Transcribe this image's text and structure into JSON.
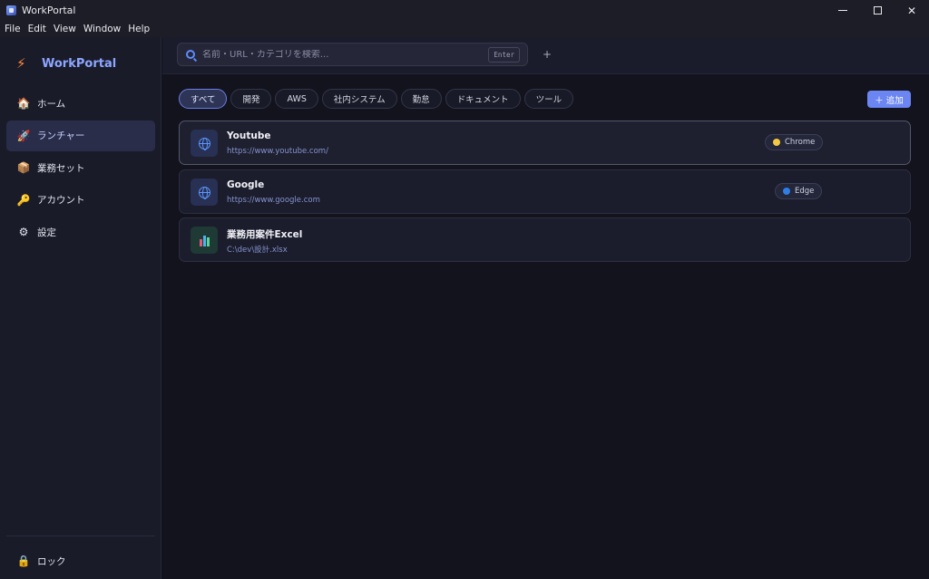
{
  "window": {
    "title": "WorkPortal"
  },
  "menu": [
    "File",
    "Edit",
    "View",
    "Window",
    "Help"
  ],
  "brand": {
    "label": "WorkPortal"
  },
  "sidebar": {
    "items": [
      {
        "label": "ホーム",
        "icon": "house-icon",
        "active": false
      },
      {
        "label": "ランチャー",
        "icon": "rocket-icon",
        "active": true
      },
      {
        "label": "業務セット",
        "icon": "package-icon",
        "active": false
      },
      {
        "label": "アカウント",
        "icon": "key-icon",
        "active": false
      },
      {
        "label": "設定",
        "icon": "gear-icon",
        "active": false
      }
    ],
    "lock": {
      "label": "ロック",
      "icon": "lock-icon"
    }
  },
  "search": {
    "placeholder": "名前・URL・カテゴリを検索...",
    "value": "",
    "enter_hint": "Enter"
  },
  "header": {
    "new_tab": "+"
  },
  "filters": [
    "すべて",
    "開発",
    "AWS",
    "社内システム",
    "勤怠",
    "ドキュメント",
    "ツール"
  ],
  "filter_active": "すべて",
  "add_button": "＋ 追加",
  "launchers": [
    {
      "title": "Youtube",
      "subtitle": "https://www.youtube.com/",
      "browser": "Chrome",
      "browser_color": "#f5c842",
      "icon": "globe-icon"
    },
    {
      "title": "Google",
      "subtitle": "https://www.google.com",
      "browser": "Edge",
      "browser_color": "#2f7ee6",
      "icon": "globe-icon"
    },
    {
      "title": "業務用案件Excel",
      "subtitle": "C:\\dev\\設計.xlsx",
      "browser": "",
      "icon": "spreadsheet-icon"
    }
  ],
  "colors": {
    "accent": "#6b86f2",
    "brand": "#8da6ff",
    "bolt": "#ff8a3d"
  }
}
